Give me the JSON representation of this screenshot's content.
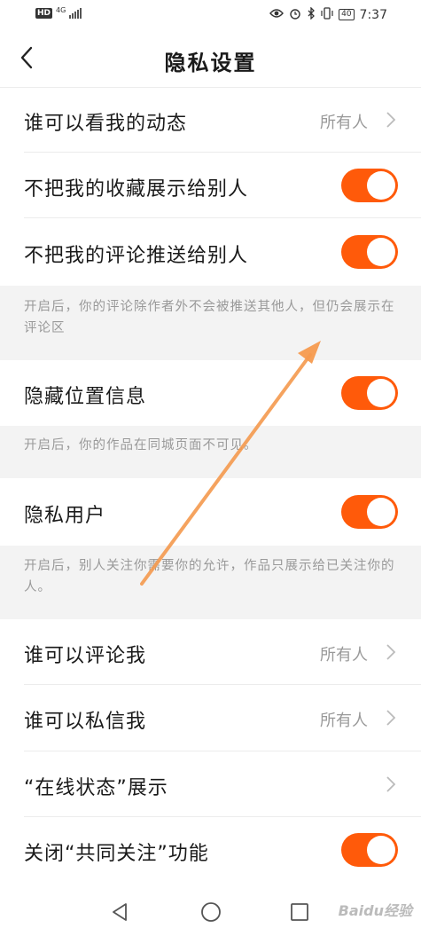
{
  "status_bar": {
    "hd": "HD",
    "network": "4G",
    "battery": "40",
    "time": "7:37",
    "icons": [
      "eye-icon",
      "alarm-icon",
      "bluetooth-icon",
      "vibrate-icon"
    ]
  },
  "header": {
    "title": "隐私设置",
    "back_icon": "chevron-left-icon"
  },
  "settings": {
    "who_can_see": {
      "label": "谁可以看我的动态",
      "value": "所有人"
    },
    "hide_favorites": {
      "label": "不把我的收藏展示给别人",
      "toggle": "on"
    },
    "hide_comments": {
      "label": "不把我的评论推送给别人",
      "toggle": "on"
    },
    "hide_comments_note": "开启后，你的评论除作者外不会被推送其他人，但仍会展示在评论区",
    "hide_location": {
      "label": "隐藏位置信息",
      "toggle": "on"
    },
    "hide_location_note": "开启后，你的作品在同城页面不可见。",
    "private_user": {
      "label": "隐私用户",
      "toggle": "on"
    },
    "private_user_note": "开启后，别人关注你需要你的允许，作品只展示给已关注你的人。",
    "who_can_comment": {
      "label": "谁可以评论我",
      "value": "所有人"
    },
    "who_can_message": {
      "label": "谁可以私信我",
      "value": "所有人"
    },
    "online_status": {
      "label": "“在线状态”展示"
    },
    "mutual_follow": {
      "label": "关闭“共同关注”功能",
      "toggle": "on"
    }
  },
  "colors": {
    "toggle_on": "#ff5a0a",
    "note_bg": "#f3f3f3",
    "annotation_arrow": "#f59a4e"
  },
  "navbar": {
    "icons": [
      "back-triangle-icon",
      "home-circle-icon",
      "recents-square-icon"
    ]
  },
  "watermark": "Baidu经验"
}
